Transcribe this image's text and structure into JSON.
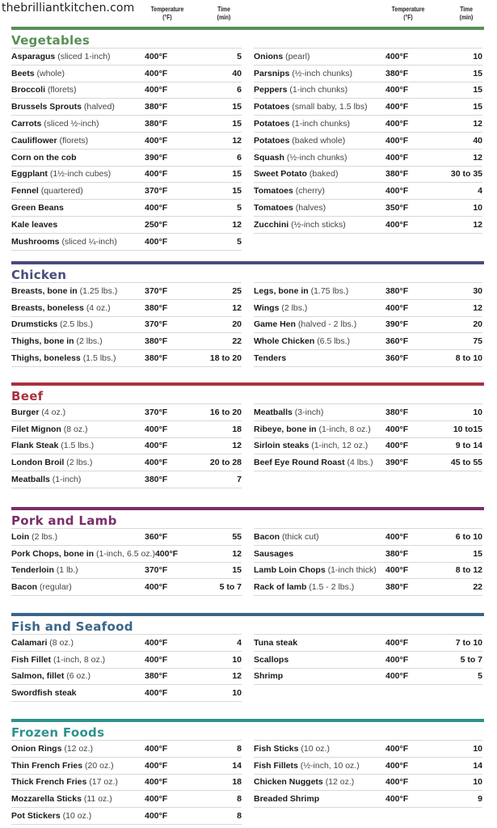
{
  "site_name": "thebrilliantkitchen.com",
  "column_headers": {
    "temperature": "Temperature (°F)",
    "temperature_line1": "Temperature",
    "temperature_line2": "(°F)",
    "time_line1": "Time",
    "time_line2": "(min)"
  },
  "colors": {
    "vegetables": "#5a8f56",
    "chicken": "#4b4a7d",
    "beef": "#a8323f",
    "pork_and_lamb": "#7a2e6a",
    "fish_and_seafood": "#3a6587",
    "frozen_foods": "#2e938c"
  },
  "sections": [
    {
      "key": "vegetables",
      "title": "Vegetables",
      "left": [
        {
          "name": "Asparagus",
          "detail": "(sliced 1-inch)",
          "temp": "400°F",
          "time": "5"
        },
        {
          "name": "Beets",
          "detail": "(whole)",
          "temp": "400°F",
          "time": "40"
        },
        {
          "name": "Broccoli",
          "detail": "(florets)",
          "temp": "400°F",
          "time": "6"
        },
        {
          "name": "Brussels Sprouts",
          "detail": "(halved)",
          "temp": "380°F",
          "time": "15"
        },
        {
          "name": "Carrots",
          "detail": "(sliced ½-inch)",
          "temp": "380°F",
          "time": "15"
        },
        {
          "name": "Cauliflower",
          "detail": "(florets)",
          "temp": "400°F",
          "time": "12"
        },
        {
          "name": "Corn on the cob",
          "detail": "",
          "temp": "390°F",
          "time": "6"
        },
        {
          "name": "Eggplant",
          "detail": "(1½-inch cubes)",
          "temp": "400°F",
          "time": "15"
        },
        {
          "name": "Fennel",
          "detail": "(quartered)",
          "temp": "370°F",
          "time": "15"
        },
        {
          "name": "Green Beans",
          "detail": "",
          "temp": "400°F",
          "time": "5"
        },
        {
          "name": "Kale leaves",
          "detail": "",
          "temp": "250°F",
          "time": "12"
        },
        {
          "name": "Mushrooms",
          "detail": "(sliced ¼-inch)",
          "temp": "400°F",
          "time": "5"
        }
      ],
      "right": [
        {
          "name": "Onions",
          "detail": "(pearl)",
          "temp": "400°F",
          "time": "10"
        },
        {
          "name": "Parsnips",
          "detail": "(½-inch chunks)",
          "temp": "380°F",
          "time": "15"
        },
        {
          "name": "Peppers",
          "detail": "(1-inch chunks)",
          "temp": "400°F",
          "time": "15"
        },
        {
          "name": "Potatoes",
          "detail": "(small baby, 1.5 lbs)",
          "temp": "400°F",
          "time": "15"
        },
        {
          "name": "Potatoes",
          "detail": "(1-inch chunks)",
          "temp": "400°F",
          "time": "12"
        },
        {
          "name": "Potatoes",
          "detail": "(baked whole)",
          "temp": "400°F",
          "time": "40"
        },
        {
          "name": "Squash",
          "detail": "(½-inch chunks)",
          "temp": "400°F",
          "time": "12"
        },
        {
          "name": "Sweet Potato",
          "detail": "(baked)",
          "temp": "380°F",
          "time": "30 to 35"
        },
        {
          "name": "Tomatoes",
          "detail": "(cherry)",
          "temp": "400°F",
          "time": "4"
        },
        {
          "name": "Tomatoes",
          "detail": "(halves)",
          "temp": "350°F",
          "time": "10"
        },
        {
          "name": "Zucchini",
          "detail": "(½-inch sticks)",
          "temp": "400°F",
          "time": "12"
        }
      ]
    },
    {
      "key": "chicken",
      "title": "Chicken",
      "left": [
        {
          "name": "Breasts, bone in",
          "detail": "(1.25 lbs.)",
          "temp": "370°F",
          "time": "25"
        },
        {
          "name": "Breasts, boneless",
          "detail": "(4 oz.)",
          "temp": "380°F",
          "time": "12"
        },
        {
          "name": "Drumsticks",
          "detail": "(2.5 lbs.)",
          "temp": "370°F",
          "time": "20"
        },
        {
          "name": "Thighs, bone in",
          "detail": "(2 lbs.)",
          "temp": "380°F",
          "time": "22"
        },
        {
          "name": "Thighs, boneless",
          "detail": "(1.5 lbs.)",
          "temp": "380°F",
          "time": "18 to 20"
        }
      ],
      "right": [
        {
          "name": "Legs, bone in",
          "detail": "(1.75 lbs.)",
          "temp": "380°F",
          "time": "30"
        },
        {
          "name": "Wings",
          "detail": "(2 lbs.)",
          "temp": "400°F",
          "time": "12"
        },
        {
          "name": "Game Hen",
          "detail": "(halved - 2 lbs.)",
          "temp": "390°F",
          "time": "20"
        },
        {
          "name": "Whole Chicken",
          "detail": "(6.5 lbs.)",
          "temp": "360°F",
          "time": "75"
        },
        {
          "name": "Tenders",
          "detail": "",
          "temp": "360°F",
          "time": "8 to 10"
        }
      ]
    },
    {
      "key": "beef",
      "title": "Beef",
      "left": [
        {
          "name": "Burger",
          "detail": "(4 oz.)",
          "temp": "370°F",
          "time": "16 to 20"
        },
        {
          "name": "Filet Mignon",
          "detail": "(8 oz.)",
          "temp": "400°F",
          "time": "18"
        },
        {
          "name": "Flank Steak",
          "detail": "(1.5 lbs.)",
          "temp": "400°F",
          "time": "12"
        },
        {
          "name": "London Broil",
          "detail": "(2 lbs.)",
          "temp": "400°F",
          "time": "20 to 28"
        },
        {
          "name": "Meatballs",
          "detail": "(1-inch)",
          "temp": "380°F",
          "time": "7"
        }
      ],
      "right": [
        {
          "name": "Meatballs",
          "detail": "(3-inch)",
          "temp": "380°F",
          "time": "10"
        },
        {
          "name": "Ribeye, bone in",
          "detail": "(1-inch, 8 oz.)",
          "temp": "400°F",
          "time": "10 to15"
        },
        {
          "name": "Sirloin steaks",
          "detail": "(1-inch, 12 oz.)",
          "temp": "400°F",
          "time": "9 to 14"
        },
        {
          "name": "Beef Eye Round Roast",
          "detail": "(4 lbs.)",
          "temp": "390°F",
          "time": "45 to 55"
        }
      ]
    },
    {
      "key": "pork_and_lamb",
      "title": "Pork and Lamb",
      "left": [
        {
          "name": "Loin",
          "detail": "(2 lbs.)",
          "temp": "360°F",
          "time": "55"
        },
        {
          "name": "Pork Chops, bone in",
          "detail": "(1-inch, 6.5 oz.)",
          "temp": "400°F",
          "time": "12"
        },
        {
          "name": "Tenderloin",
          "detail": "(1 lb.)",
          "temp": "370°F",
          "time": "15"
        },
        {
          "name": "Bacon",
          "detail": "(regular)",
          "temp": "400°F",
          "time": "5 to 7"
        }
      ],
      "right": [
        {
          "name": "Bacon",
          "detail": "(thick cut)",
          "temp": "400°F",
          "time": "6 to 10"
        },
        {
          "name": "Sausages",
          "detail": "",
          "temp": "380°F",
          "time": "15"
        },
        {
          "name": "Lamb Loin Chops",
          "detail": "(1-inch thick)",
          "temp": "400°F",
          "time": "8 to 12"
        },
        {
          "name": "Rack of lamb",
          "detail": "(1.5 - 2 lbs.)",
          "temp": "380°F",
          "time": "22"
        }
      ]
    },
    {
      "key": "fish_and_seafood",
      "title": "Fish and Seafood",
      "left": [
        {
          "name": "Calamari",
          "detail": "(8 oz.)",
          "temp": "400°F",
          "time": "4"
        },
        {
          "name": "Fish Fillet",
          "detail": "(1-inch, 8 oz.)",
          "temp": "400°F",
          "time": "10"
        },
        {
          "name": "Salmon, fillet",
          "detail": "(6 oz.)",
          "temp": "380°F",
          "time": "12"
        },
        {
          "name": "Swordfish steak",
          "detail": "",
          "temp": "400°F",
          "time": "10"
        }
      ],
      "right": [
        {
          "name": "Tuna steak",
          "detail": "",
          "temp": "400°F",
          "time": "7 to 10"
        },
        {
          "name": "Scallops",
          "detail": "",
          "temp": "400°F",
          "time": "5 to 7"
        },
        {
          "name": "Shrimp",
          "detail": "",
          "temp": "400°F",
          "time": "5"
        }
      ]
    },
    {
      "key": "frozen_foods",
      "title": "Frozen Foods",
      "left": [
        {
          "name": "Onion Rings",
          "detail": "(12 oz.)",
          "temp": "400°F",
          "time": "8"
        },
        {
          "name": "Thin French Fries",
          "detail": "(20 oz.)",
          "temp": "400°F",
          "time": "14"
        },
        {
          "name": "Thick French Fries",
          "detail": "(17 oz.)",
          "temp": "400°F",
          "time": "18"
        },
        {
          "name": "Mozzarella Sticks",
          "detail": "(11 oz.)",
          "temp": "400°F",
          "time": "8"
        },
        {
          "name": "Pot Stickers",
          "detail": "(10 oz.)",
          "temp": "400°F",
          "time": "8"
        }
      ],
      "right": [
        {
          "name": "Fish Sticks",
          "detail": "(10 oz.)",
          "temp": "400°F",
          "time": "10"
        },
        {
          "name": "Fish Fillets",
          "detail": "(½-inch, 10 oz.)",
          "temp": "400°F",
          "time": "14"
        },
        {
          "name": "Chicken Nuggets",
          "detail": "(12 oz.)",
          "temp": "400°F",
          "time": "10"
        },
        {
          "name": "Breaded Shrimp",
          "detail": "",
          "temp": "400°F",
          "time": "9"
        }
      ]
    }
  ]
}
